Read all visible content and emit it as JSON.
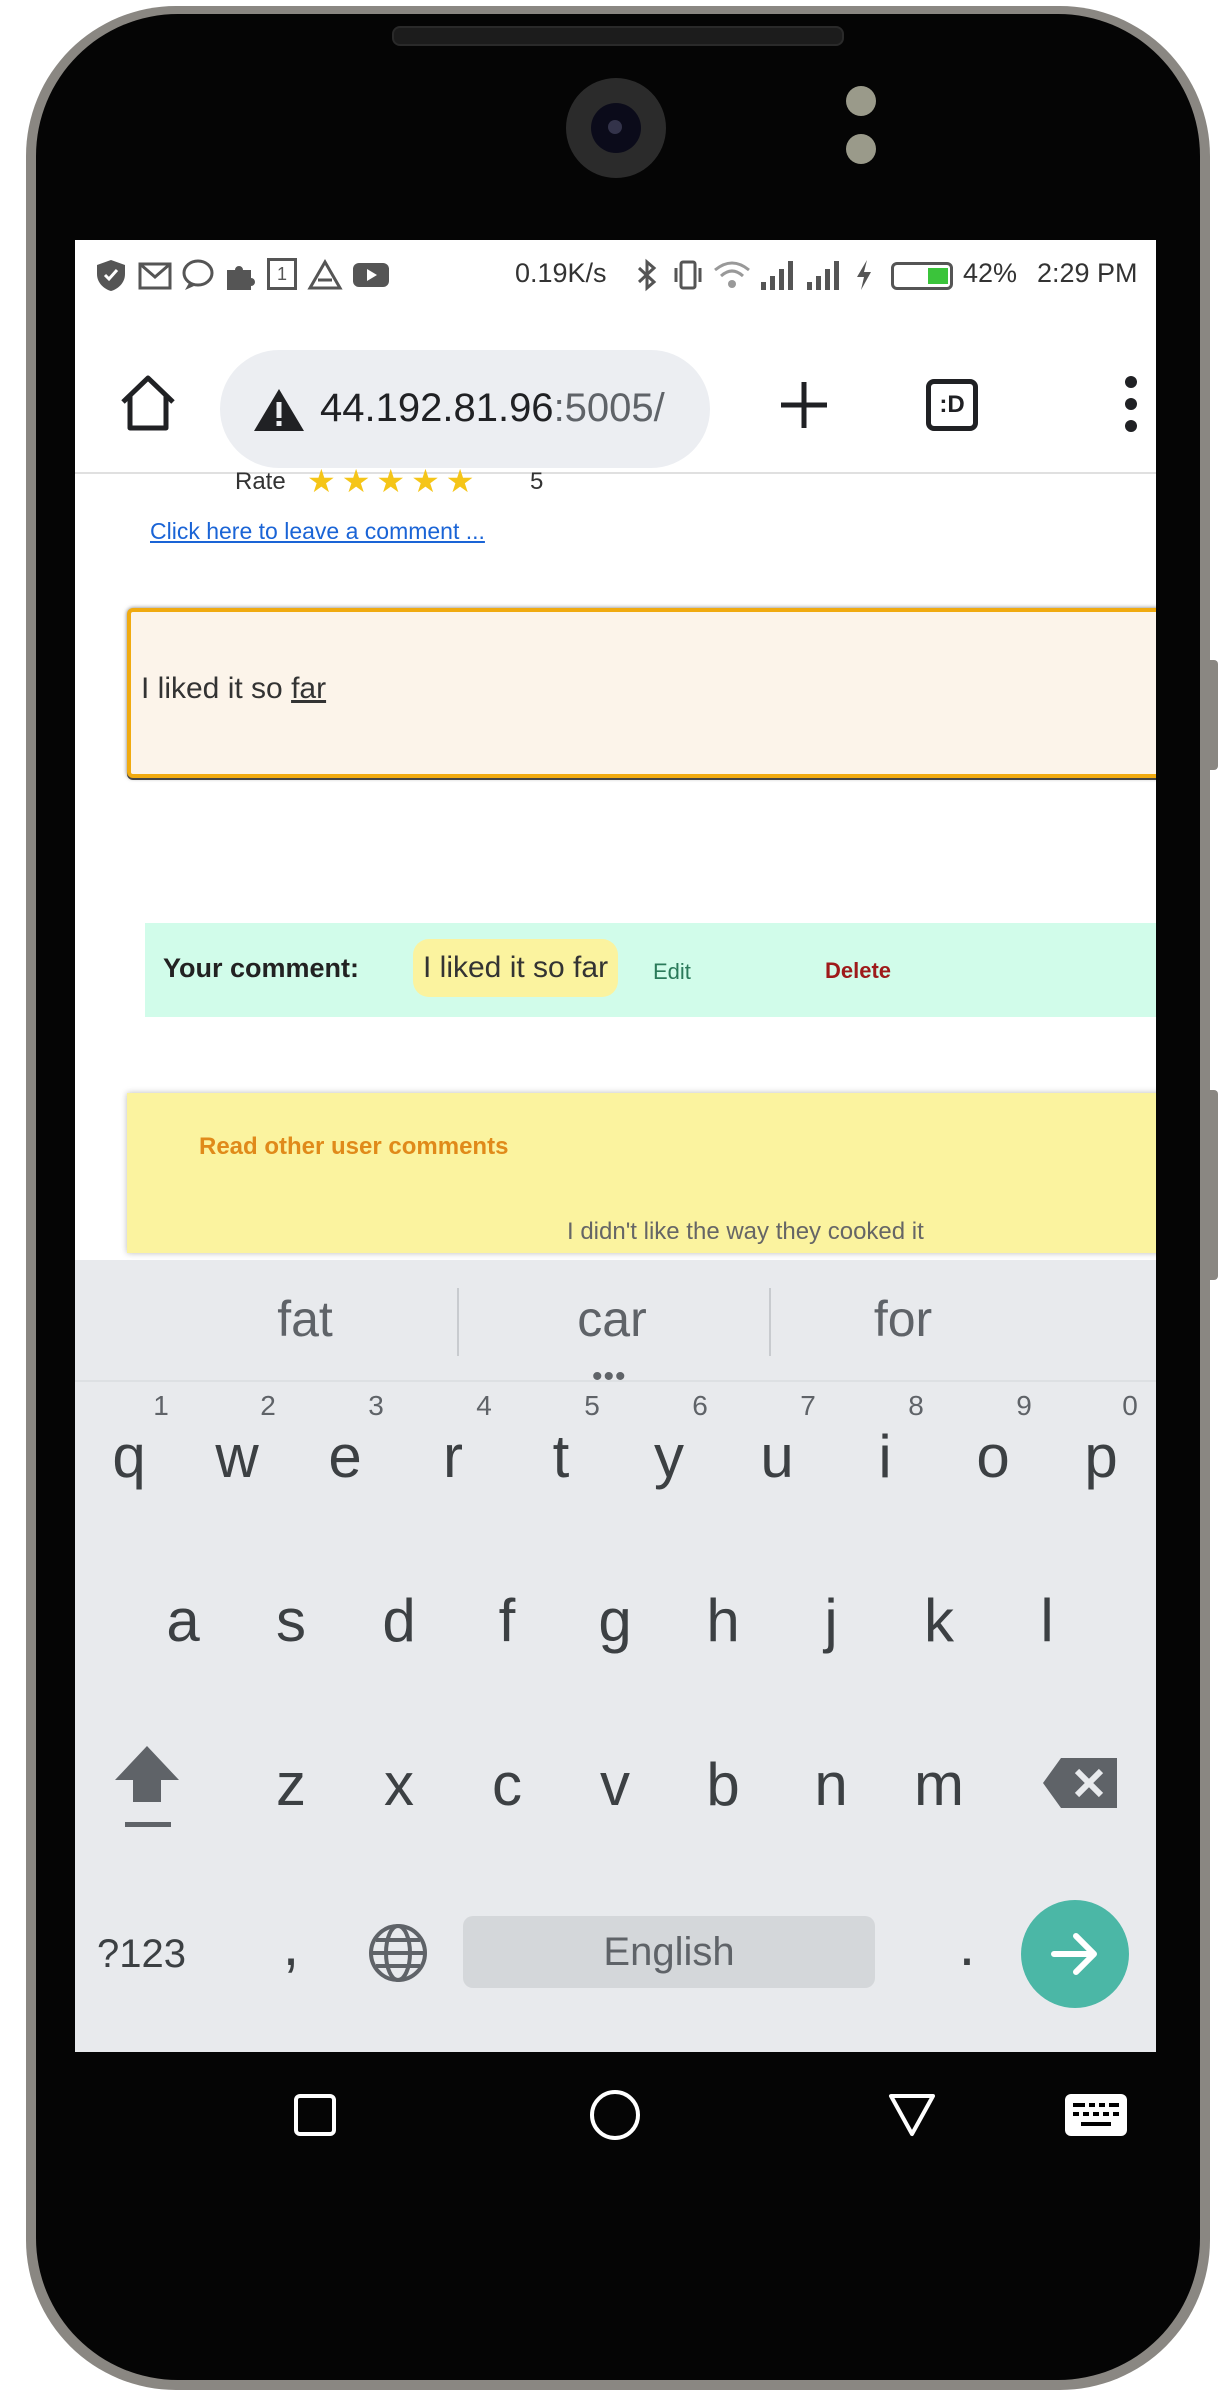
{
  "status_bar": {
    "speed": "0.19K/s",
    "battery": "42%",
    "time": "2:29 PM",
    "icons": [
      "shield-icon",
      "gmail-icon",
      "chat-icon",
      "puzzle-icon",
      "calendar-icon",
      "drive-icon",
      "youtube-icon",
      "bluetooth-icon",
      "vibrate-icon",
      "wifi-icon",
      "signal-icon",
      "signal-icon",
      "charging-icon",
      "battery-icon"
    ],
    "calendar_day": "1"
  },
  "browser": {
    "url_host": "44.192.81.96",
    "url_port": ":5005/",
    "tab_switcher_label": ":D",
    "icons": [
      "home-icon",
      "warning-icon",
      "new-tab-icon",
      "tab-switcher-icon",
      "more-icon"
    ]
  },
  "page": {
    "rate_label": "Rate",
    "rate_stars": "★★★★★",
    "rate_value": "5",
    "rating": 5,
    "comment_link": "Click here to leave a comment ...",
    "comment_input_prefix": "I liked it so ",
    "comment_input_current_word": "far",
    "your_comment_label": "Your comment:",
    "your_comment_text": "I liked it so far",
    "edit_label": "Edit",
    "delete_label": "Delete",
    "others_title": "Read other user comments",
    "others_partial_text": "I didn't like the way they cooked it"
  },
  "keyboard": {
    "suggestions": [
      "fat",
      "car",
      "for"
    ],
    "suggestion_more": "•••",
    "row1": [
      "q",
      "w",
      "e",
      "r",
      "t",
      "y",
      "u",
      "i",
      "o",
      "p"
    ],
    "row1_hints": [
      "1",
      "2",
      "3",
      "4",
      "5",
      "6",
      "7",
      "8",
      "9",
      "0"
    ],
    "row2": [
      "a",
      "s",
      "d",
      "f",
      "g",
      "h",
      "j",
      "k",
      "l"
    ],
    "row3": [
      "z",
      "x",
      "c",
      "v",
      "b",
      "n",
      "m"
    ],
    "symbols_label": "?123",
    "comma": ",",
    "period": ".",
    "space_label": "English",
    "icons": [
      "shift-icon",
      "backspace-icon",
      "globe-icon",
      "enter-arrow-icon"
    ]
  },
  "nav_bar": {
    "icons": [
      "recents-square-icon",
      "home-circle-icon",
      "back-triangle-icon",
      "keyboard-icon"
    ]
  },
  "colors": {
    "input_bg": "#fcf4ea",
    "input_border": "#f0aa10",
    "your_comment_bg": "#d1fcea",
    "pill_bg": "#fbf39f",
    "delete_red": "#9e1a1a",
    "others_title": "#e08a1a",
    "enter_key": "#4bb7a6",
    "link": "#1a64d6",
    "star": "#f5c518"
  }
}
